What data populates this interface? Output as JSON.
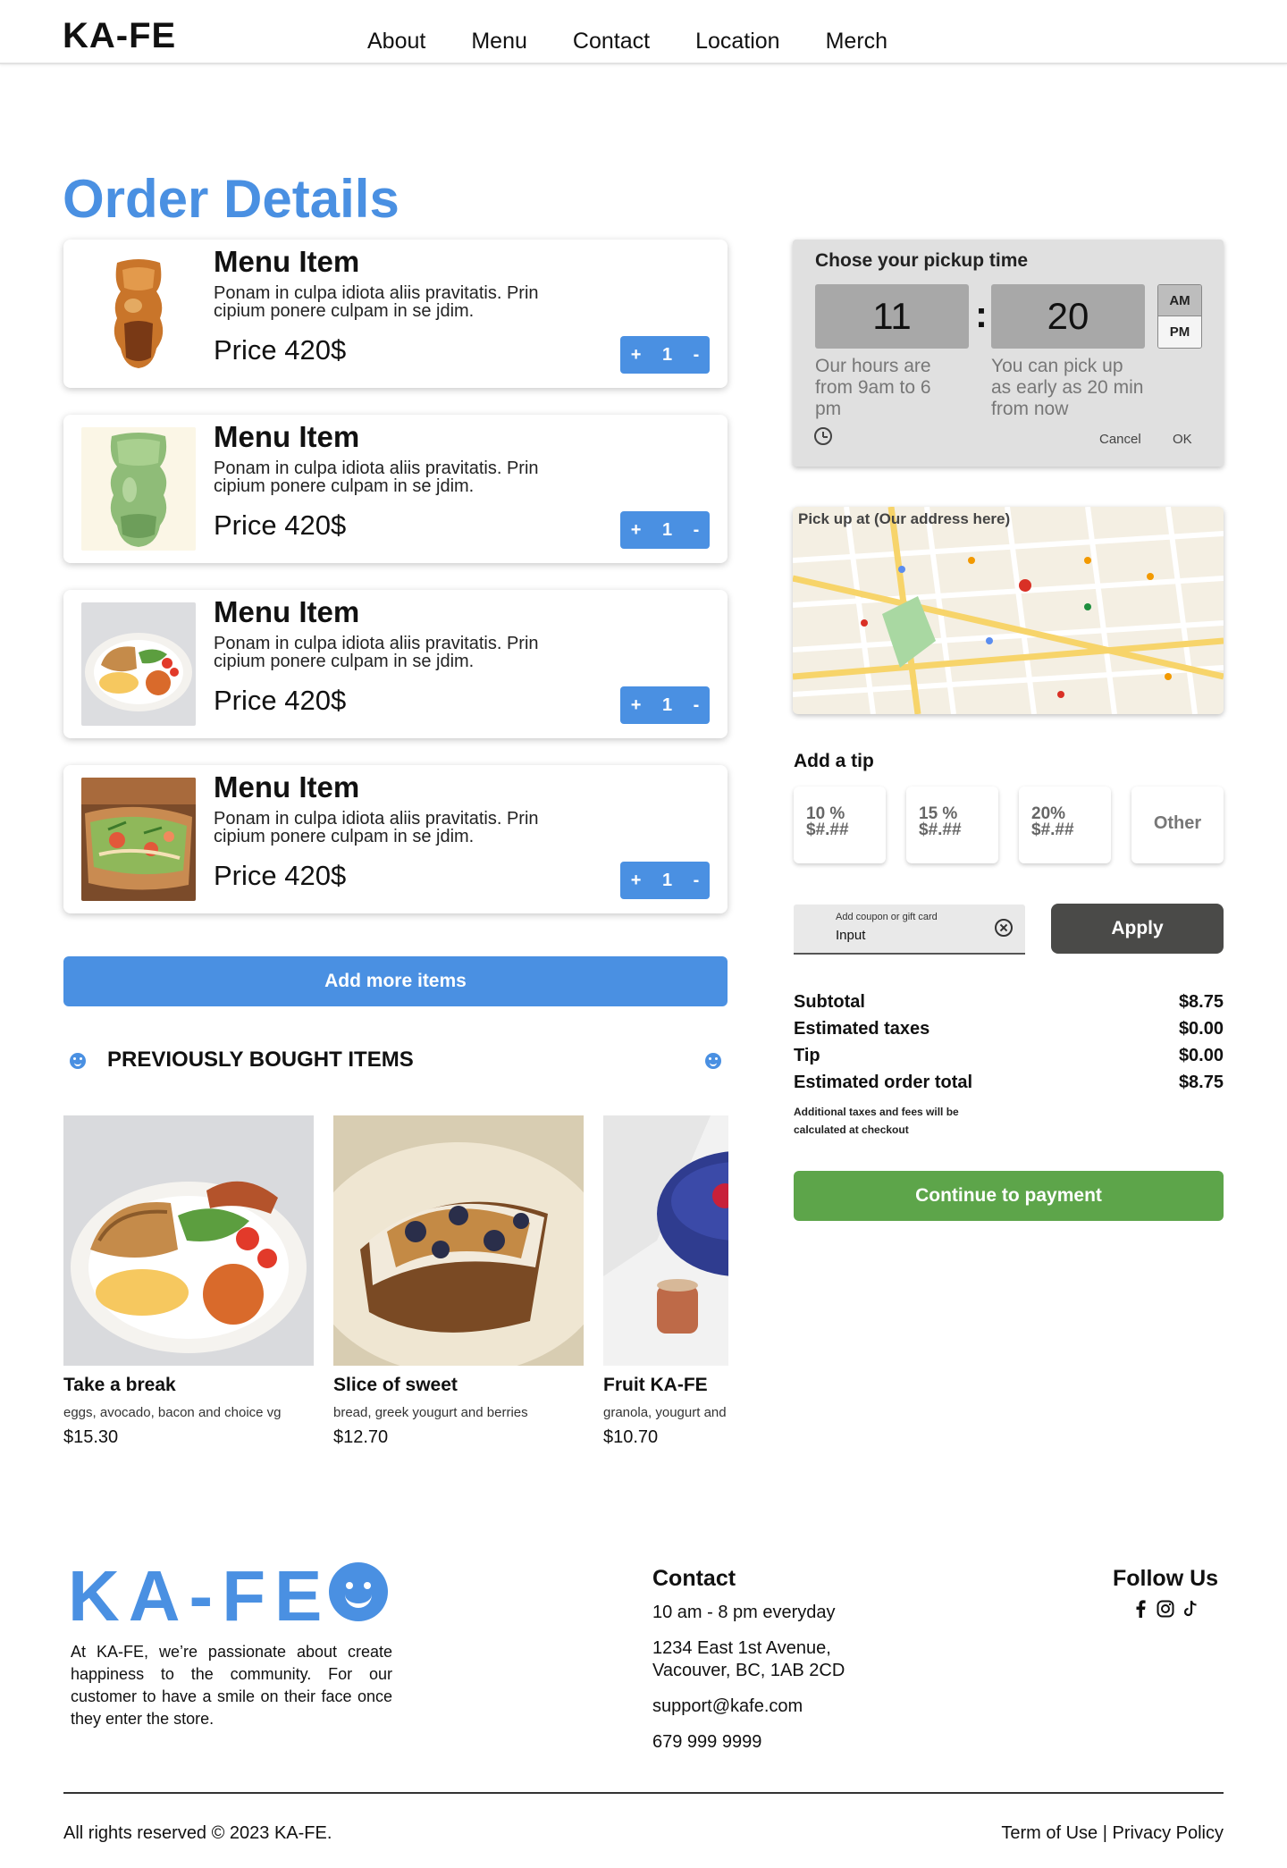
{
  "header": {
    "logo": "KA-FE",
    "nav": [
      "About",
      "Menu",
      "Contact",
      "Location",
      "Merch"
    ]
  },
  "page_title": "Order Details",
  "order_items": [
    {
      "name": "Menu Item",
      "description": "Ponam in culpa idiota aliis pravitatis. Prin cipium ponere culpam in se jdim.",
      "price": "Price 420$",
      "qty": "1",
      "plus": "+",
      "minus": "-",
      "image": "iced-coffee-cup"
    },
    {
      "name": "Menu Item",
      "description": "Ponam in culpa idiota aliis pravitatis. Prin cipium ponere culpam in se jdim.",
      "price": "Price 420$",
      "qty": "1",
      "plus": "+",
      "minus": "-",
      "image": "matcha-cup"
    },
    {
      "name": "Menu Item",
      "description": "Ponam in culpa idiota aliis pravitatis. Prin cipium ponere culpam in se jdim.",
      "price": "Price 420$",
      "qty": "1",
      "plus": "+",
      "minus": "-",
      "image": "breakfast-plate"
    },
    {
      "name": "Menu Item",
      "description": "Ponam in culpa idiota aliis pravitatis. Prin cipium ponere culpam in se jdim.",
      "price": "Price 420$",
      "qty": "1",
      "plus": "+",
      "minus": "-",
      "image": "avocado-toast"
    }
  ],
  "add_more_label": "Add more items",
  "previously_bought": {
    "title": "PREVIOUSLY BOUGHT ITEMS",
    "items": [
      {
        "name": "Take a break",
        "description": "eggs, avocado, bacon and choice vg",
        "price": "$15.30"
      },
      {
        "name": "Slice of sweet",
        "description": "bread, greek yougurt and berries",
        "price": "$12.70"
      },
      {
        "name": "Fruit KA-FE",
        "description": "granola, yougurt and fruits",
        "price": "$10.70"
      }
    ]
  },
  "pickup": {
    "title": "Chose your pickup time",
    "hour": "11",
    "minute": "20",
    "separator": ":",
    "am": "AM",
    "pm": "PM",
    "hours_hint": "Our hours are from 9am to 6 pm",
    "early_hint": "You can pick up as early as 20 min from now",
    "cancel": "Cancel",
    "ok": "OK"
  },
  "map": {
    "label": "Pick up at (Our address here)"
  },
  "tip": {
    "title": "Add a tip",
    "options": [
      {
        "pct": "10 %",
        "amount": "$#.##"
      },
      {
        "pct": "15 %",
        "amount": "$#.##"
      },
      {
        "pct": "20%",
        "amount": "$#.##"
      }
    ],
    "other": "Other"
  },
  "coupon": {
    "label": "Add coupon or gift card",
    "value": "Input",
    "apply": "Apply"
  },
  "totals": [
    {
      "label": "Subtotal",
      "value": "$8.75"
    },
    {
      "label": "Estimated taxes",
      "value": "$0.00"
    },
    {
      "label": "Tip",
      "value": "$0.00"
    },
    {
      "label": "Estimated order total",
      "value": "$8.75"
    }
  ],
  "fees_note": "Additional taxes and fees will be calculated at checkout",
  "continue_label": "Continue to payment",
  "footer": {
    "logo": "KA-FE",
    "about": "At KA-FE, we’re passionate about create happiness to the community. For our customer to have a smile on their face once they enter the store.",
    "contact_title": "Contact",
    "hours": "10 am - 8 pm everyday",
    "address_line1": "1234 East 1st Avenue,",
    "address_line2": "Vacouver, BC, 1AB 2CD",
    "email": "support@kafe.com",
    "phone": "679 999 9999",
    "follow_title": "Follow Us",
    "copyright": "All rights reserved © 2023 KA-FE.",
    "terms": "Term of Use",
    "divider": "|",
    "privacy": "Privacy Policy"
  },
  "colors": {
    "brand_blue": "#4a90e2",
    "continue_green": "#5da54a",
    "apply_dark": "#4a4a48"
  }
}
